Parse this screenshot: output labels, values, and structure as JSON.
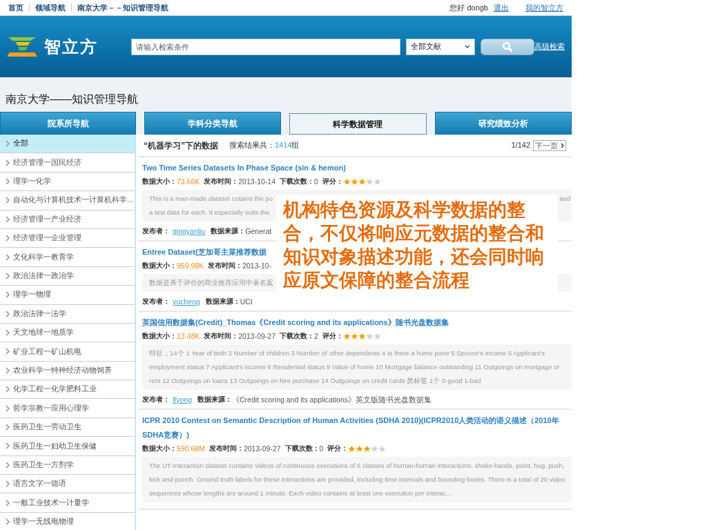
{
  "top_links": [
    "首页",
    "领域导航",
    "南京大学－－知识管理导航"
  ],
  "greeting": "您好 dongb",
  "logout": "退出",
  "my_link": "我的智立方",
  "logo_text": "智立方",
  "search": {
    "placeholder": "请输入检索条件",
    "scope": "全部文献",
    "advanced": "高级检索"
  },
  "page_title": "南京大学——知识管理导航",
  "tabs": [
    {
      "label": "学科分类导航",
      "selected": false
    },
    {
      "label": "科学数据管理",
      "selected": true
    },
    {
      "label": "研究绩效分析",
      "selected": false
    }
  ],
  "sidebar": {
    "title": "院系所导航",
    "items": [
      {
        "label": "全部",
        "selected": true
      },
      {
        "label": "经济管理一国民经济",
        "selected": false
      },
      {
        "label": "理学一化学",
        "selected": false
      },
      {
        "label": "自动化与计算机技术一计算机科学...",
        "selected": false
      },
      {
        "label": "经济管理一产业经济",
        "selected": false
      },
      {
        "label": "经济管理一企业管理",
        "selected": false
      },
      {
        "label": "文化科学一教育学",
        "selected": false
      },
      {
        "label": "政治法律一政治学",
        "selected": false
      },
      {
        "label": "理学一物理",
        "selected": false
      },
      {
        "label": "政治法律一法学",
        "selected": false
      },
      {
        "label": "天文地球一地质学",
        "selected": false
      },
      {
        "label": "矿业工程一矿山机电",
        "selected": false
      },
      {
        "label": "农业科学一特种经济动物饲养",
        "selected": false
      },
      {
        "label": "化学工程一化学肥料工业",
        "selected": false
      },
      {
        "label": "哲学宗教一应用心理学",
        "selected": false
      },
      {
        "label": "医药卫生一劳动卫生",
        "selected": false
      },
      {
        "label": "医药卫生一妇幼卫生保健",
        "selected": false
      },
      {
        "label": "医药卫生一方剂学",
        "selected": false
      },
      {
        "label": "语言文字一德语",
        "selected": false
      },
      {
        "label": "一般工业技术一计量学",
        "selected": false
      },
      {
        "label": "理学一无线电物理",
        "selected": false
      }
    ]
  },
  "results_header": {
    "title": "“机器学习”下的数据",
    "count_label": "搜索结果共：",
    "count": "1414",
    "count_unit": "组",
    "page": "1/142",
    "next": "下一页"
  },
  "results": [
    {
      "title": "Two Time Series Datasets In Phase Space (sin & hemon)",
      "meta": [
        {
          "label": "数据大小：",
          "value": "73.66K",
          "kind": "size"
        },
        {
          "label": "发布时间：",
          "value": "2013-10-14",
          "kind": "plain"
        },
        {
          "label": "下载次数：",
          "value": "0",
          "kind": "plain"
        },
        {
          "label": "评分：",
          "kind": "rating",
          "stars": 3
        }
      ],
      "description_lines": [
        "This is a man-made dataset cotains the po",
        "a test data for each. It especially suits the"
      ],
      "description_tail": "and",
      "publisher_label": "发布者：",
      "publisher": "qingyanliu",
      "source_label": "数据来源：",
      "source": "Generat"
    },
    {
      "title": "Entree Dataset(芝加哥主菜推荐数据",
      "meta": [
        {
          "label": "数据大小：",
          "value": "959.98K",
          "kind": "size"
        },
        {
          "label": "发布时间：",
          "value": "2013-10-",
          "kind": "plain"
        }
      ],
      "description_lines": [
        "数据是基于评价的商业推荐应用中著名案"
      ],
      "publisher_label": "发布者：",
      "publisher": "yucheng",
      "source_label": "数据来源：",
      "source": "UCI"
    },
    {
      "title": "英国信用数据集(Credit)_Thomas《Credit scoring and its applications》随书光盘数据集",
      "meta": [
        {
          "label": "数据大小：",
          "value": "13.48K",
          "kind": "size"
        },
        {
          "label": "发布时间：",
          "value": "2013-09-27",
          "kind": "plain"
        },
        {
          "label": "下载次数：",
          "value": "2",
          "kind": "plain"
        },
        {
          "label": "评分：",
          "kind": "rating",
          "stars": 3
        }
      ],
      "description": "特征，14个  1 Year of birth 2 Number of children 3 Number of other dependents 4 Is there a home pone 5 Spouse's income 6 Applicant's employment status 7 Applicant's income 8 Residential status 9 Value of home 10 Mortgage balance outstanding 11 Outgoings on mortgage or rent 12 Outgoings on loans 13 Outgoings on hire purchase 14 Outgoings on credit cards 类标签  1个  0-good 1-bad",
      "publisher_label": "发布者：",
      "publisher": "ltyong",
      "source_label": "数据来源：",
      "source": "《Credit scoring and its applications》英文版随书光盘数据集"
    },
    {
      "title": "ICPR 2010 Contest on Semantic Description of Human Activities (SDHA 2010)(ICPR2010人类活动的语义描述（2010年SDHA竞赛）)",
      "meta": [
        {
          "label": "数据大小：",
          "value": "590.68M",
          "kind": "size"
        },
        {
          "label": "发布时间：",
          "value": "2013-09-27",
          "kind": "plain"
        },
        {
          "label": "下载次数：",
          "value": "0",
          "kind": "plain"
        },
        {
          "label": "评分：",
          "kind": "rating",
          "stars": 3
        }
      ],
      "description": "The UT-Interaction dataset contains videos of continuous executions of 6 classes of human-human interactions: shake-hands, point, hug, push, kick and punch. Ground truth labels for these interactions are provided, including time intervals and bounding boxes. There is a total of 20 video sequences whose lengths are around 1 minute. Each video contains at least one execution per interac..."
    }
  ],
  "callout": "机构特色资源及科学数据的整合，不仅将响应元数据的整合和知识对象描述功能，还会同时响应原文保障的整合流程"
}
